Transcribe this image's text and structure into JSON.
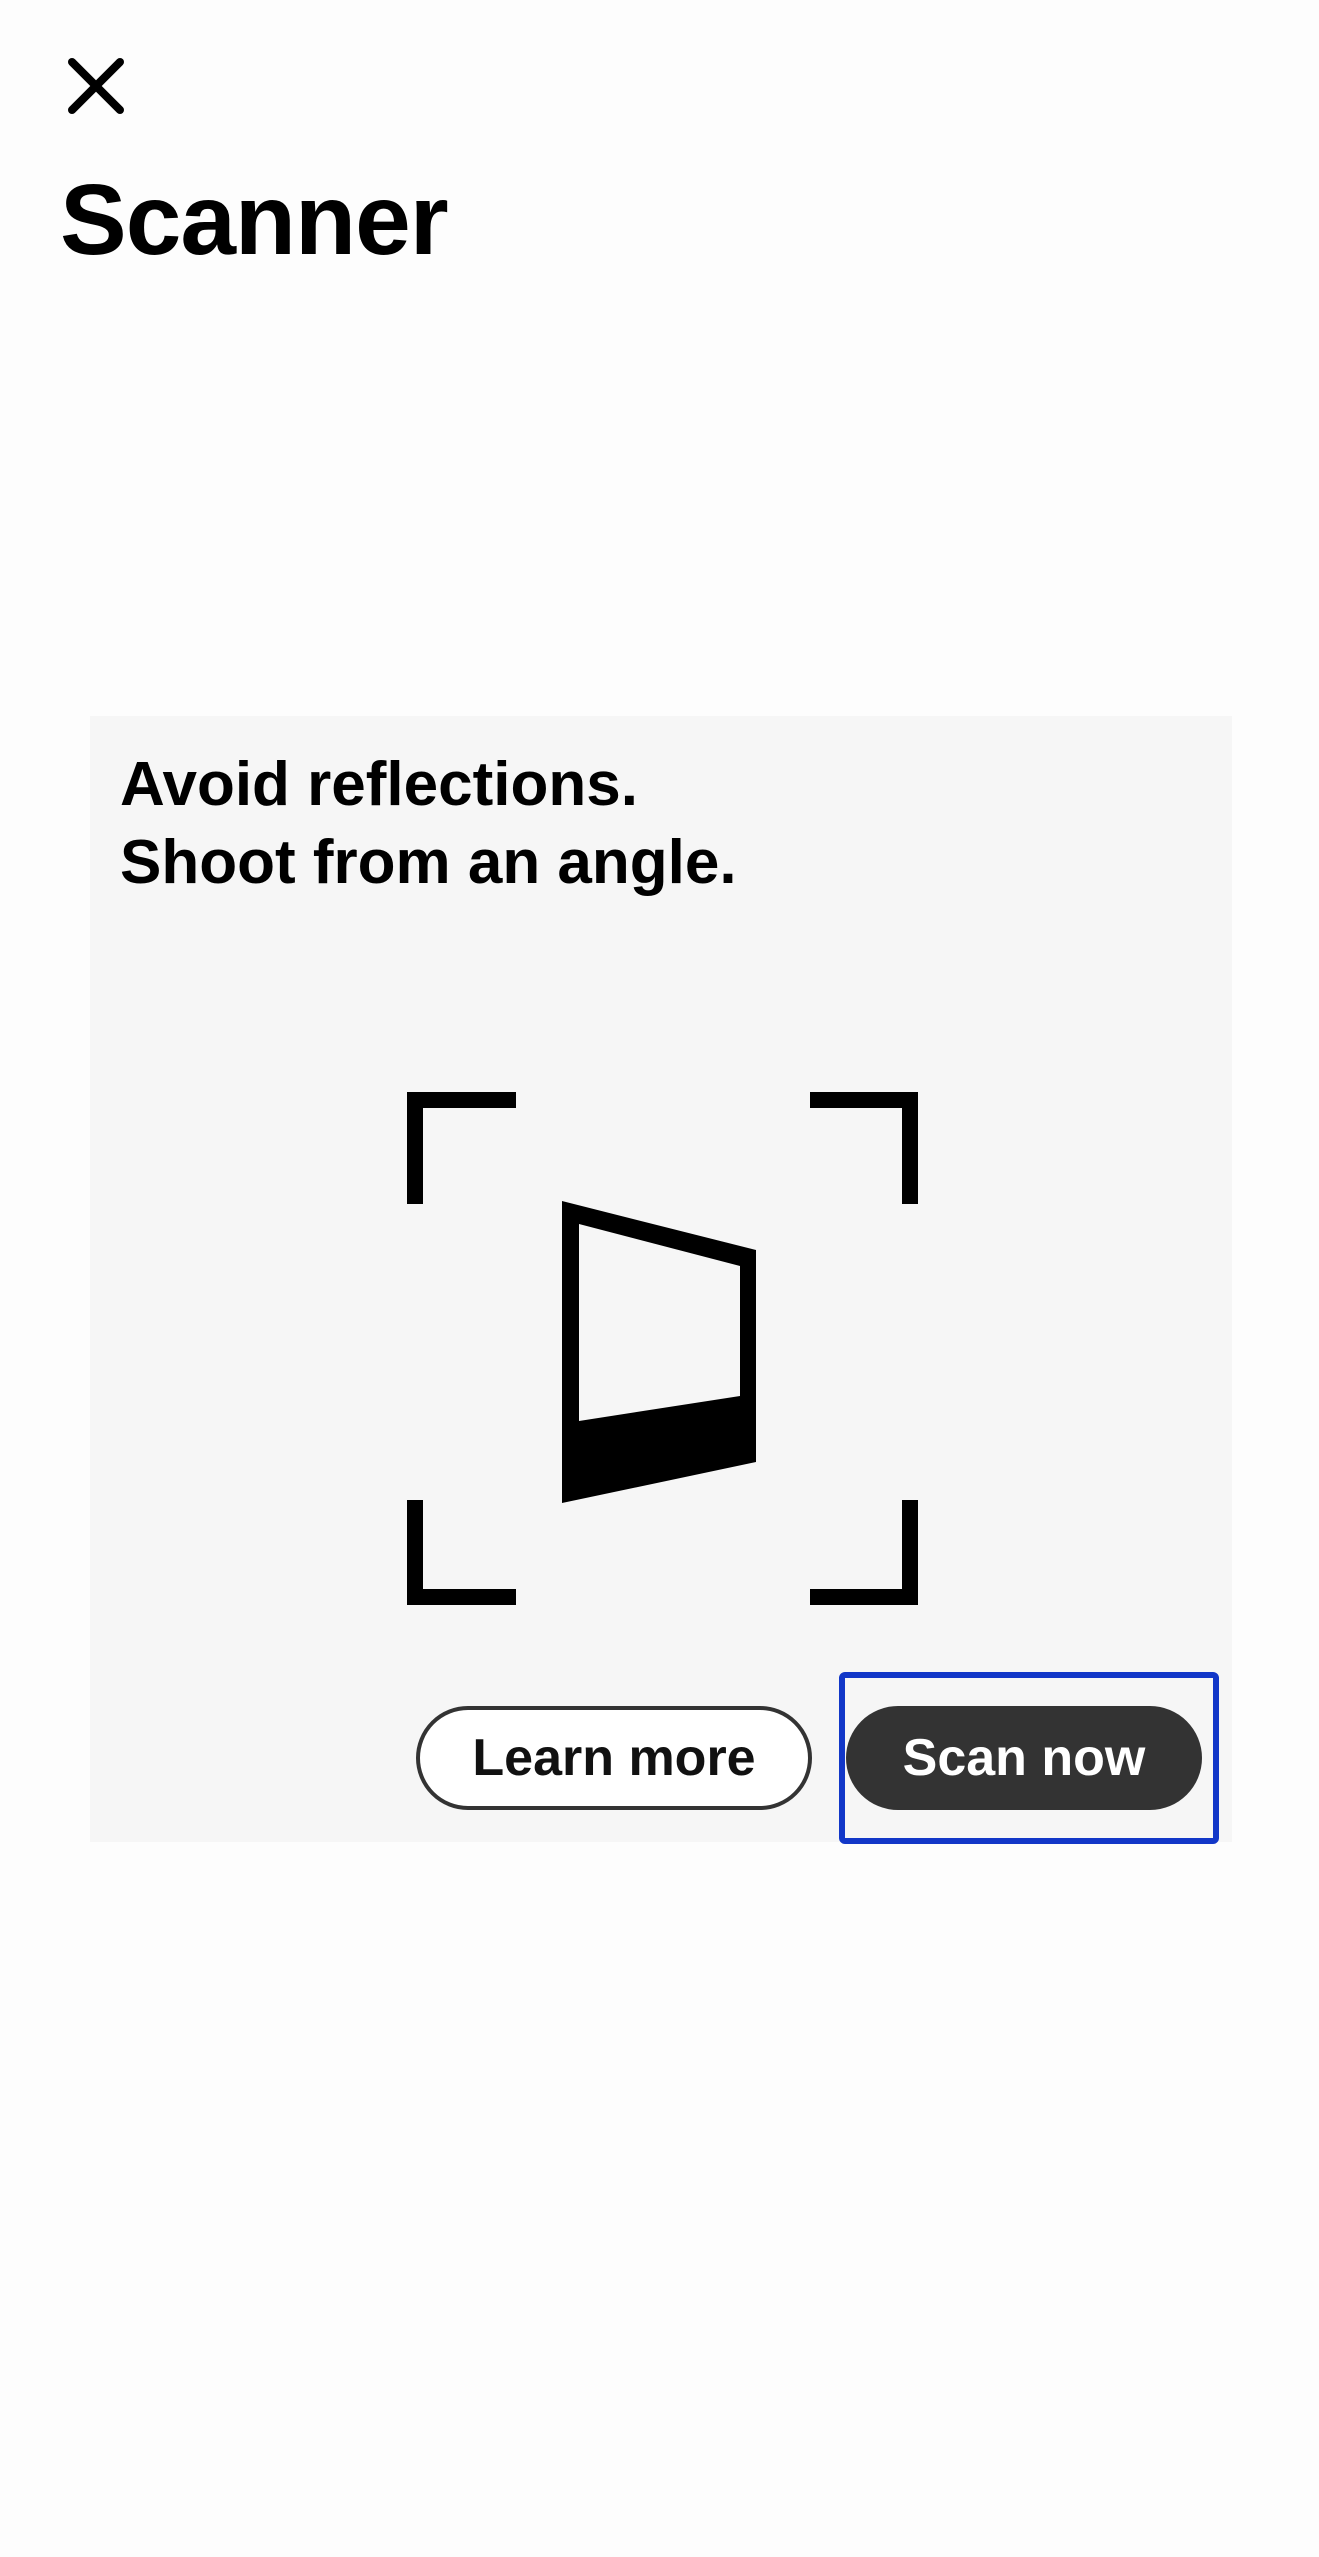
{
  "header": {
    "close_icon": "close-icon",
    "title": "Scanner"
  },
  "card": {
    "tip_line_1": "Avoid reflections.",
    "tip_line_2": "Shoot from an angle.",
    "illustration_icon": "angled-document-in-viewfinder-icon",
    "learn_more_label": "Learn more",
    "scan_now_label": "Scan now"
  },
  "colors": {
    "background": "#fdfdfd",
    "card_background": "#f6f6f6",
    "primary_button": "#333333",
    "focus_highlight": "#1237c8"
  }
}
